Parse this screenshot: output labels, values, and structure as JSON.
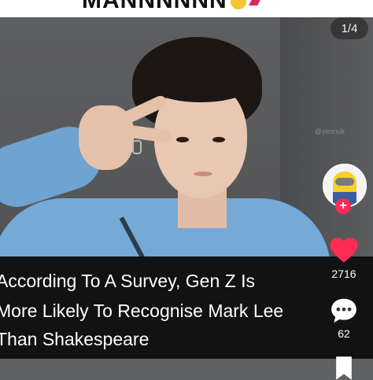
{
  "header": {
    "caption_text": "MANNNNNN",
    "emoji": [
      "smiling-face-emoji",
      "hundred-points-emoji"
    ]
  },
  "photo": {
    "counter": "1/4",
    "watermark": "@yeonuk"
  },
  "caption": {
    "lines": [
      "According To A Survey, Gen Z Is",
      "More Likely To Recognise Mark Lee",
      "Than Shakespeare"
    ]
  },
  "sidebar": {
    "follow_label": "+",
    "like_count": "2716",
    "comment_count": "62"
  },
  "colors": {
    "like": "#fe2c55",
    "caption_bg": "#121212",
    "shirt": "#75a9d6"
  }
}
